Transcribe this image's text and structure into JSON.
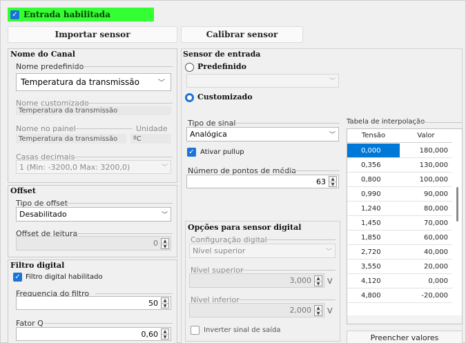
{
  "enable": {
    "label": "Entrada habilitada",
    "checked": true
  },
  "buttons": {
    "import": "Importar sensor",
    "calibrate": "Calibrar sensor"
  },
  "channel": {
    "title": "Nome do Canal",
    "predefined_label": "Nome predefinido",
    "predefined_value": "Temperatura da transmissão",
    "custom_label": "Nome customizado",
    "custom_value": "Temperatura da transmissão",
    "panel_name_label": "Nome no painel",
    "panel_name_value": "Temperatura da transmissão",
    "unit_label": "Unidade",
    "unit_value": "ºC",
    "decimals_label": "Casas decimais",
    "decimals_value": "1 (Min: -3200,0 Max: 3200,0)"
  },
  "offset": {
    "title": "Offset",
    "type_label": "Tipo de offset",
    "type_value": "Desabilitado",
    "reading_label": "Offset de leitura",
    "reading_value": "0"
  },
  "filter": {
    "title": "Filtro digital",
    "enabled_label": "Filtro digital habilitado",
    "freq_label": "Frequencia do filtro",
    "freq_value": "50",
    "factor_label": "Fator Q",
    "factor_value": "0,60"
  },
  "sensor": {
    "title": "Sensor de entrada",
    "predefined_label": "Predefinido",
    "custom_label": "Customizado",
    "selected": "Customizado",
    "signal_type_label": "Tipo de sinal",
    "signal_type_value": "Analógica",
    "pullup_label": "Ativar pullup",
    "avg_label": "Número de pontos de média",
    "avg_value": "63"
  },
  "digital": {
    "title": "Opções para sensor digital",
    "config_label": "Configuração digital",
    "config_value": "Nível superior",
    "upper_label": "Nível superior",
    "upper_value": "3,000",
    "lower_label": "Nível inferior",
    "lower_value": "2,000",
    "unit": "V",
    "invert_label": "Inverter sinal de saída"
  },
  "interp": {
    "title": "Tabela de interpolação",
    "headers": [
      "Tensão",
      "Valor"
    ],
    "rows": [
      [
        "0,000",
        "180,000"
      ],
      [
        "0,356",
        "130,000"
      ],
      [
        "0,800",
        "100,000"
      ],
      [
        "0,990",
        "90,000"
      ],
      [
        "1,240",
        "80,000"
      ],
      [
        "1,450",
        "70,000"
      ],
      [
        "1,850",
        "60,000"
      ],
      [
        "2,720",
        "40,000"
      ],
      [
        "3,550",
        "20,000"
      ],
      [
        "4,120",
        "0,000"
      ],
      [
        "4,800",
        "-20,000"
      ]
    ],
    "fill_button": "Preencher valores"
  },
  "colors": {
    "accent": "#1a73d6",
    "enabled_bar": "#33ff33",
    "selection": "#0078d7"
  }
}
